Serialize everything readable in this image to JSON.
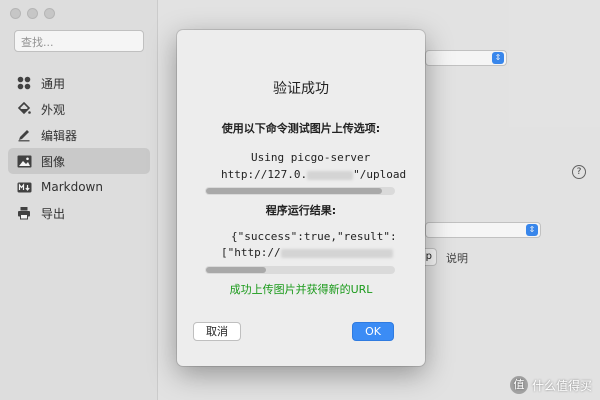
{
  "window": {
    "search_placeholder": "查找..."
  },
  "sidebar": {
    "items": [
      {
        "label": "通用",
        "icon": "grid-icon"
      },
      {
        "label": "外观",
        "icon": "paint-bucket-icon"
      },
      {
        "label": "编辑器",
        "icon": "pencil-icon"
      },
      {
        "label": "图像",
        "icon": "image-icon"
      },
      {
        "label": "Markdown",
        "icon": "markdown-icon"
      },
      {
        "label": "导出",
        "icon": "printer-icon"
      }
    ],
    "active_index": 3
  },
  "main": {
    "small_button": "...p",
    "explain_link": "说明"
  },
  "dialog": {
    "title": "验证成功",
    "prompt": "使用以下命令测试图片上传选项:",
    "command_line1": "Using picgo-server",
    "command_line2_start": "http://127.0.",
    "command_line2_end": "\"/upload",
    "result_label": "程序运行结果:",
    "result_line1": "{\"success\":true,\"result\":",
    "result_line2_start": "[\"http://",
    "success_message": "成功上传图片并获得新的URL",
    "cancel_label": "取消",
    "ok_label": "OK"
  },
  "watermark": {
    "symbol": "值",
    "text": "什么值得买"
  },
  "colors": {
    "accent": "#3b8cf5",
    "success": "#1a9a1a"
  }
}
